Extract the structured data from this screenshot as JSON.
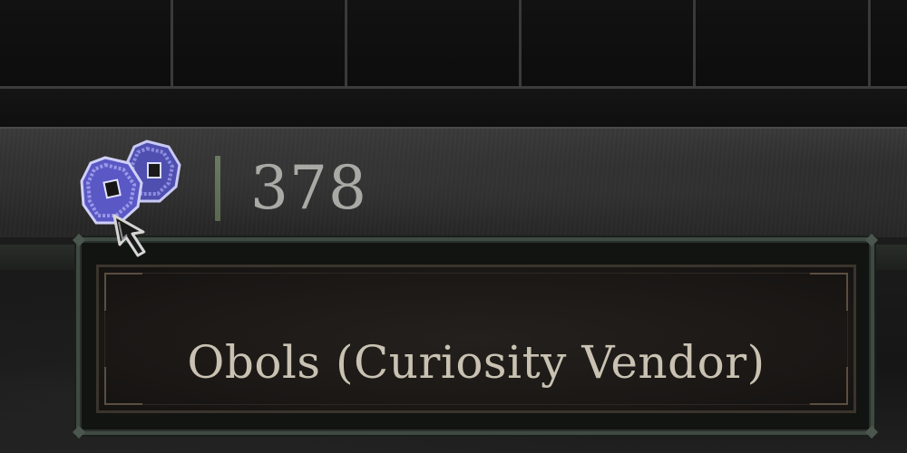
{
  "inventory_grid": {
    "cells": 6
  },
  "currency": {
    "icon": "obol-coins-icon",
    "value": "378",
    "icon_color": "#6a6fd0",
    "divider_color": "#627060"
  },
  "tooltip": {
    "title": "Obols (Curiosity Vendor)"
  },
  "cursor": {
    "icon": "arrow-cursor-icon"
  }
}
